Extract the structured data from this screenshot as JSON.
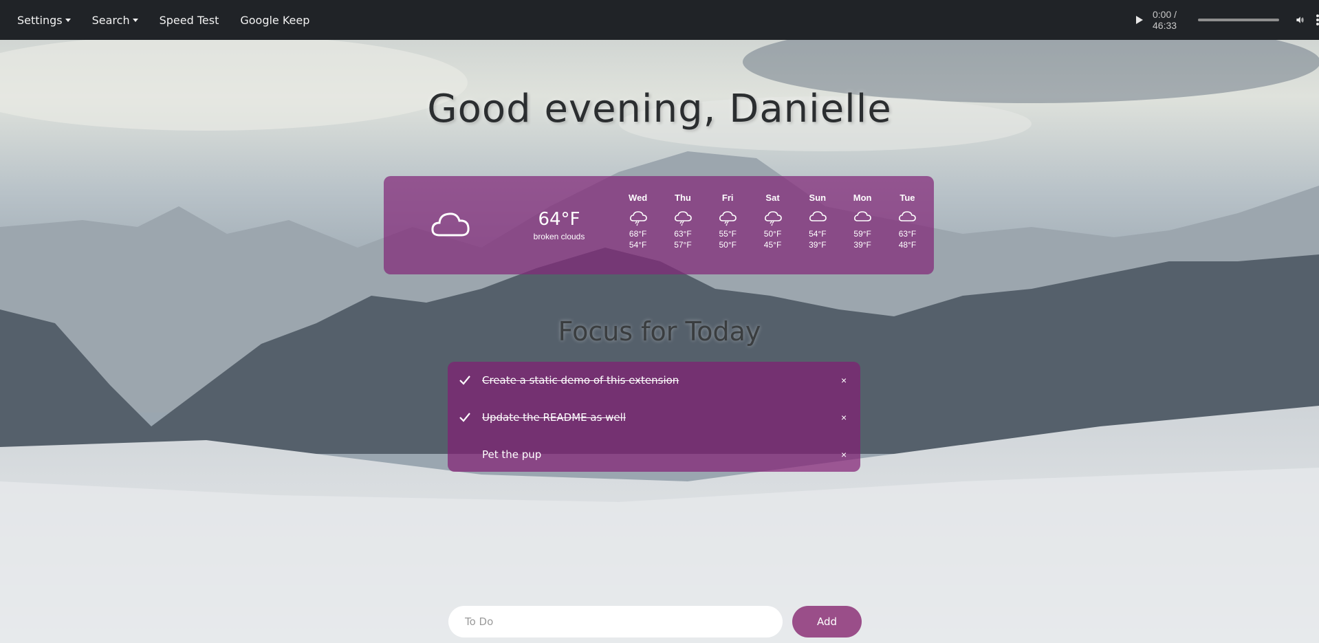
{
  "nav": {
    "settings_label": "Settings",
    "search_label": "Search",
    "speedtest_label": "Speed Test",
    "keep_label": "Google Keep"
  },
  "audio": {
    "time": "0:00 / 46:33",
    "progress": 0
  },
  "greeting": "Good evening, Danielle",
  "weather": {
    "current_temp": "64°F",
    "current_desc": "broken clouds",
    "current_icon": "cloud-icon",
    "forecast": [
      {
        "day": "Wed",
        "icon": "rain-cloud-icon",
        "hi": "68°F",
        "lo": "54°F"
      },
      {
        "day": "Thu",
        "icon": "rain-cloud-icon",
        "hi": "63°F",
        "lo": "57°F"
      },
      {
        "day": "Fri",
        "icon": "rain-cloud-icon",
        "hi": "55°F",
        "lo": "50°F"
      },
      {
        "day": "Sat",
        "icon": "rain-cloud-icon",
        "hi": "50°F",
        "lo": "45°F"
      },
      {
        "day": "Sun",
        "icon": "cloud-icon",
        "hi": "54°F",
        "lo": "39°F"
      },
      {
        "day": "Mon",
        "icon": "cloud-icon",
        "hi": "59°F",
        "lo": "39°F"
      },
      {
        "day": "Tue",
        "icon": "cloud-icon",
        "hi": "63°F",
        "lo": "48°F"
      }
    ]
  },
  "focus": {
    "title": "Focus for Today",
    "items": [
      {
        "text": "Create a static demo of this extension",
        "done": true,
        "remove": "×"
      },
      {
        "text": "Update the README as well",
        "done": true,
        "remove": "×"
      },
      {
        "text": "Pet the pup",
        "done": false,
        "remove": "×"
      }
    ]
  },
  "input": {
    "placeholder": "To Do",
    "add_label": "Add"
  },
  "colors": {
    "navbar": "#202327",
    "panel": "#82287a",
    "accent": "#8c3278"
  }
}
